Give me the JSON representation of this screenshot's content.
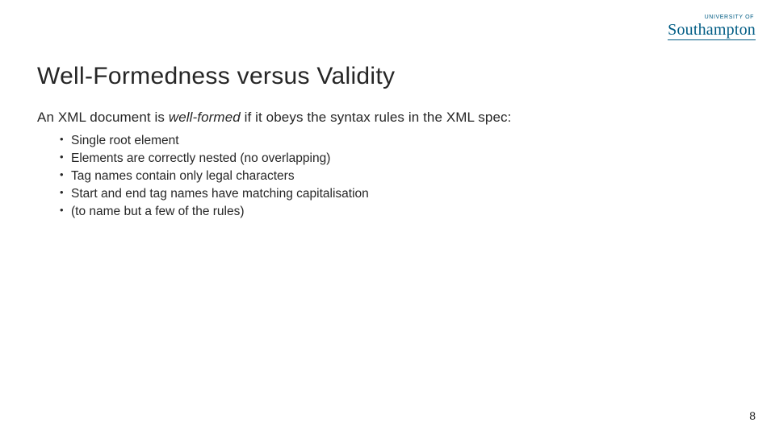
{
  "logo": {
    "topline": "UNIVERSITY OF",
    "wordmark": "Southampton"
  },
  "title": "Well-Formedness versus Validity",
  "intro": {
    "pre": "An XML document is ",
    "italic": "well-formed",
    "post": " if it obeys the syntax rules in the XML spec:"
  },
  "bullets": [
    "Single root element",
    "Elements are correctly nested (no overlapping)",
    "Tag names contain only legal characters",
    "Start and end tag names have matching capitalisation",
    "(to name but a few of the rules)"
  ],
  "page_number": "8"
}
